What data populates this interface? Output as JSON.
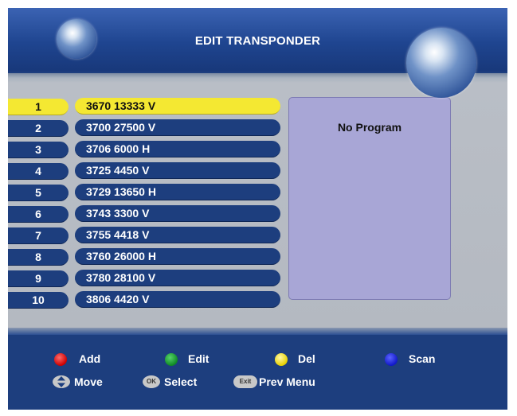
{
  "header": {
    "title": "EDIT TRANSPONDER"
  },
  "transponders": [
    {
      "num": "1",
      "value": "3670 13333 V",
      "selected": true
    },
    {
      "num": "2",
      "value": "3700 27500 V"
    },
    {
      "num": "3",
      "value": "3706 6000 H"
    },
    {
      "num": "4",
      "value": "3725 4450 V"
    },
    {
      "num": "5",
      "value": "3729 13650 H"
    },
    {
      "num": "6",
      "value": "3743 3300 V"
    },
    {
      "num": "7",
      "value": "3755 4418 V"
    },
    {
      "num": "8",
      "value": "3760 26000 H"
    },
    {
      "num": "9",
      "value": "3780 28100 V"
    },
    {
      "num": "10",
      "value": "3806 4420 V"
    }
  ],
  "info_panel": {
    "text": "No Program"
  },
  "footer": {
    "add": "Add",
    "edit": "Edit",
    "del": "Del",
    "scan": "Scan",
    "move": "Move",
    "select": "Select",
    "ok_glyph": "OK",
    "prev_menu": "Prev Menu",
    "exit_glyph": "Exit"
  },
  "colors": {
    "background_blue": "#1d3e7e",
    "highlight_yellow": "#f4e832",
    "info_panel": "#a8a6d6",
    "add_key": "red",
    "edit_key": "green",
    "del_key": "yellow",
    "scan_key": "blue"
  },
  "icons": {
    "add": "red-dot-icon",
    "edit": "green-dot-icon",
    "del": "yellow-dot-icon",
    "scan": "blue-dot-icon",
    "move": "up-down-arrows-icon",
    "select": "ok-button-icon",
    "prev_menu": "exit-button-icon"
  }
}
